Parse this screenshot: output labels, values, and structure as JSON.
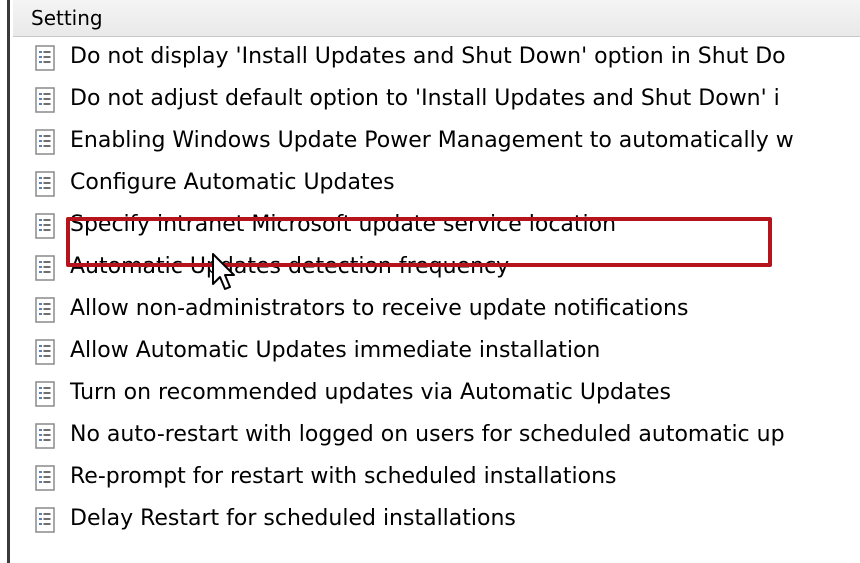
{
  "header": {
    "label": "Setting"
  },
  "icon_name": "policy-document-icon",
  "settings": [
    {
      "label": "Do not display 'Install Updates and Shut Down' option in Shut Do"
    },
    {
      "label": "Do not adjust default option to 'Install Updates and Shut Down' i"
    },
    {
      "label": "Enabling Windows Update Power Management to automatically w"
    },
    {
      "label": "Configure Automatic Updates"
    },
    {
      "label": "Specify intranet Microsoft update service location"
    },
    {
      "label": "Automatic Updates detection frequency"
    },
    {
      "label": "Allow non-administrators to receive update notifications"
    },
    {
      "label": "Allow Automatic Updates immediate installation"
    },
    {
      "label": "Turn on recommended updates via Automatic Updates"
    },
    {
      "label": "No auto-restart with logged on users for scheduled automatic up"
    },
    {
      "label": "Re-prompt for restart with scheduled installations"
    },
    {
      "label": "Delay Restart for scheduled installations"
    }
  ],
  "highlight": {
    "color": "#b5141c"
  }
}
